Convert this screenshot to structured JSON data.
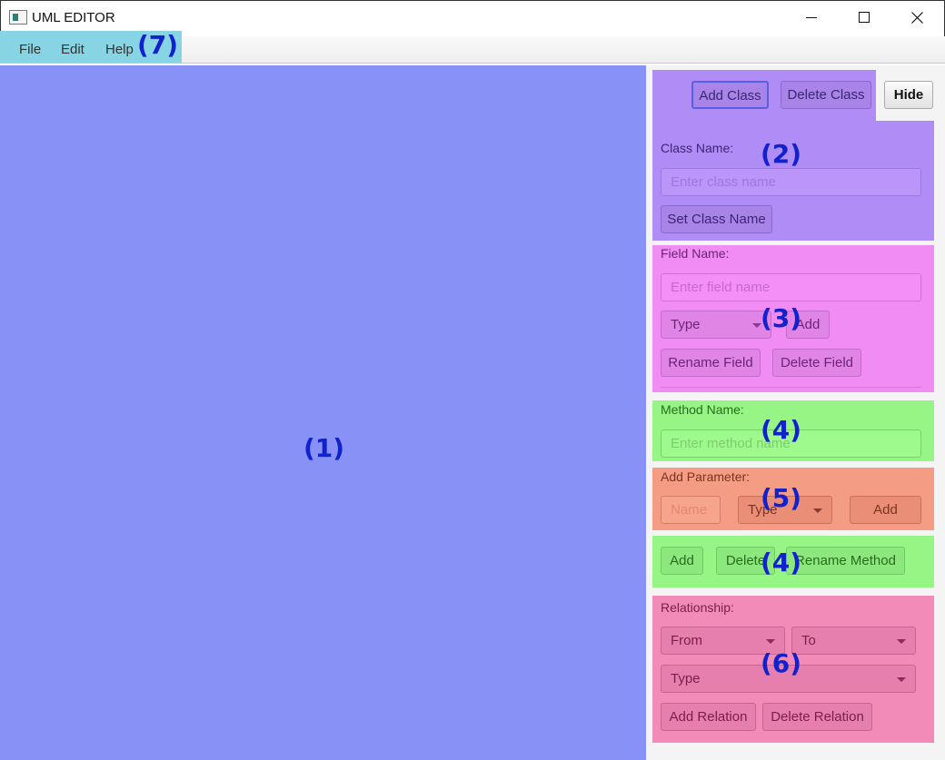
{
  "window": {
    "title": "UML EDITOR",
    "icon": "app-window-icon",
    "controls": [
      "minimize-icon",
      "maximize-icon",
      "close-icon"
    ]
  },
  "menubar": {
    "items": [
      {
        "label": "File"
      },
      {
        "label": "Edit"
      },
      {
        "label": "Help"
      }
    ]
  },
  "annotations": {
    "canvas": "(1)",
    "class": "(2)",
    "field": "(3)",
    "method": "(4)",
    "param": "(5)",
    "method_actions": "(4)",
    "relation": "(6)",
    "menu": "(7)"
  },
  "class_section": {
    "add_class": "Add Class",
    "delete_class": "Delete Class",
    "hide": "Hide",
    "name_label": "Class Name:",
    "name_placeholder": "Enter class name",
    "set_name": "Set Class Name"
  },
  "field_section": {
    "name_label": "Field Name:",
    "name_placeholder": "Enter field name",
    "type_combo": "Type",
    "add": "Add",
    "rename": "Rename Field",
    "delete": "Delete Field"
  },
  "method_section": {
    "name_label": "Method Name:",
    "name_placeholder": "Enter method name"
  },
  "param_section": {
    "label": "Add Parameter:",
    "name_placeholder": "Name",
    "type_combo": "Type",
    "add": "Add"
  },
  "method_actions": {
    "add": "Add",
    "delete": "Delete",
    "rename": "Rename Method"
  },
  "relation_section": {
    "label": "Relationship:",
    "from_combo": "From",
    "to_combo": "To",
    "type_combo": "Type",
    "add": "Add Relation",
    "delete": "Delete Relation"
  },
  "colors": {
    "canvas": "#8891f6",
    "class_section": "#b08cf6",
    "field_section": "#f08cf3",
    "method_section": "#97f586",
    "param_section": "#f49d84",
    "relation_section": "#f28bb8",
    "menu_highlight": "#87d4e5",
    "annotation": "#1122cc"
  }
}
